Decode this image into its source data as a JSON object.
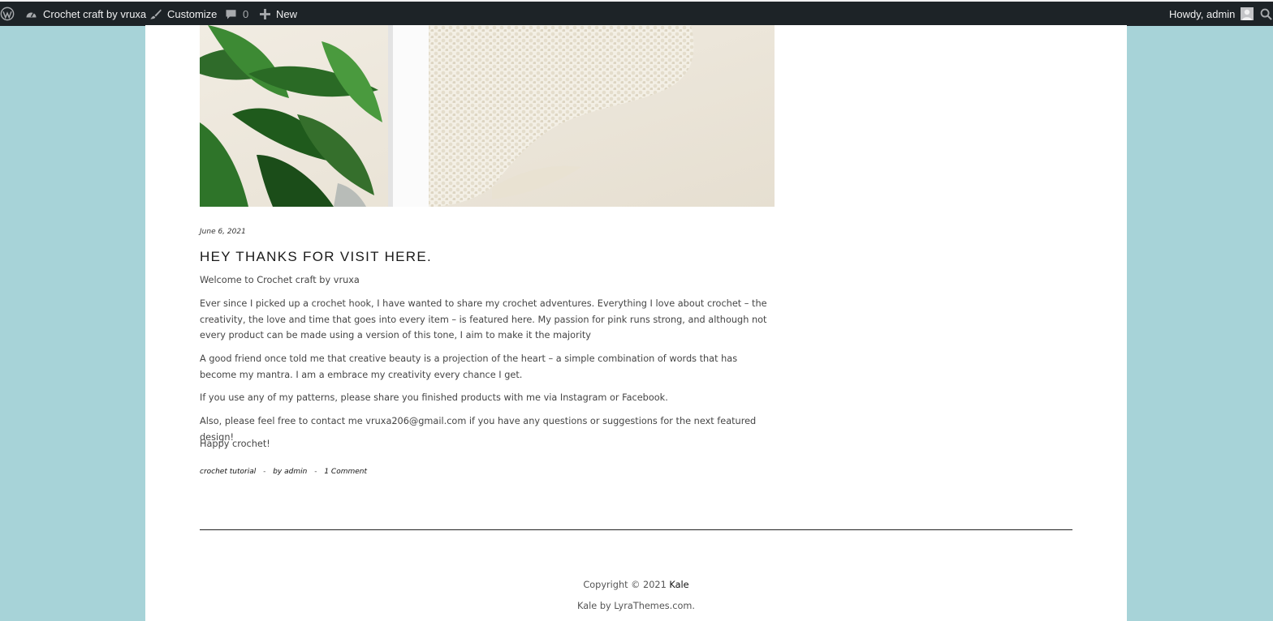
{
  "admin_bar": {
    "site_name": "Crochet craft by vruxa",
    "customize_label": "Customize",
    "comments_count": "0",
    "new_label": "New",
    "greeting": "Howdy, admin",
    "icons": [
      "wordpress-logo-icon",
      "dashboard-icon",
      "brush-icon",
      "comment-bubble-icon",
      "plus-icon",
      "avatar-icon",
      "search-icon"
    ]
  },
  "post": {
    "date": "June 6, 2021",
    "title": "HEY THANKS FOR VISIT HERE.",
    "paragraphs": [
      "Welcome to Crochet craft by vruxa",
      "Ever since I picked up a crochet hook, I have wanted to share my crochet adventures. Everything I love about crochet – the creativity, the love and time that goes into every item – is featured here. My passion for pink runs strong, and although not every product can be made using a version of this tone, I aim to make it the majority",
      "A good friend once told me that creative beauty is a projection of the heart – a simple combination of words that has become my mantra. I am a embrace my creativity every chance I get.",
      "If you use any of my patterns, please share you finished products with me via Instagram or Facebook.",
      "Also, please feel free to contact me vruxa206@gmail.com if you have any questions or suggestions for the next featured design!",
      "Happy crochet!"
    ],
    "meta": {
      "category": "crochet tutorial",
      "separator": "-",
      "author": "by admin",
      "comments": "1 Comment"
    }
  },
  "footer": {
    "copyright_text": "Copyright © 2021 ",
    "copyright_link": "Kale",
    "credit_link": "Kale",
    "credit_text": " by LyraThemes.com."
  },
  "colors": {
    "background": "#a7d3d8",
    "admin_bar": "#1d2327",
    "page": "#ffffff"
  }
}
